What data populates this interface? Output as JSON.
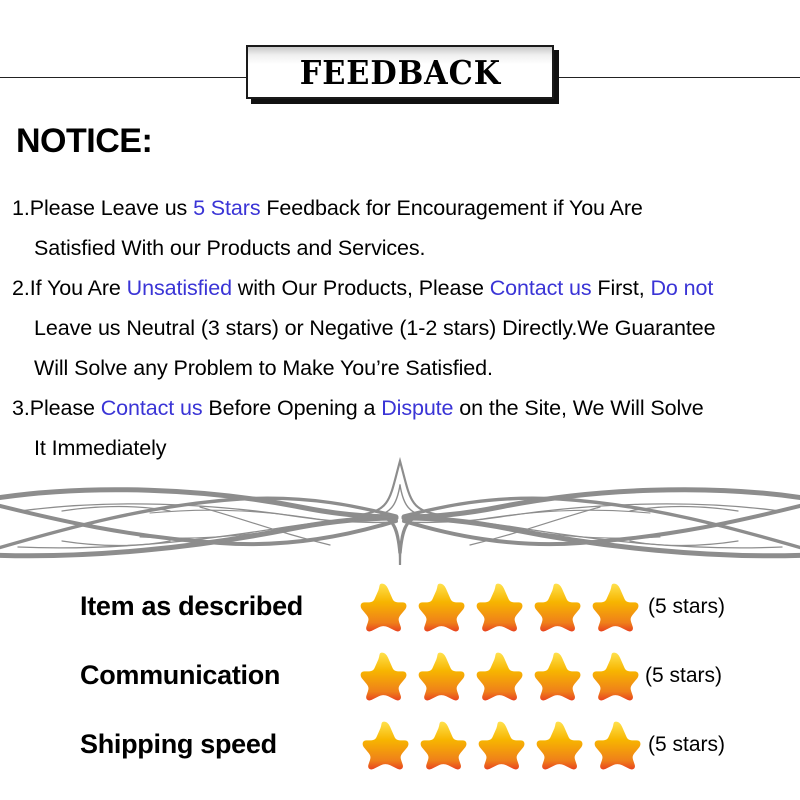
{
  "banner": {
    "title": "FEEDBACK"
  },
  "notice": {
    "heading": "NOTICE:",
    "highlight_color": "#3a34d6",
    "items": [
      {
        "lines": [
          [
            {
              "text": "1.Please Leave us ",
              "color": "black"
            },
            {
              "text": " 5 Stars ",
              "color": "highlight"
            },
            {
              "text": " Feedback for  Encouragement  if You Are",
              "color": "black"
            }
          ],
          [
            {
              "text": "Satisfied With our Products and Services.",
              "color": "black"
            }
          ]
        ]
      },
      {
        "lines": [
          [
            {
              "text": "2.If You Are ",
              "color": "black"
            },
            {
              "text": "Unsatisfied",
              "color": "highlight"
            },
            {
              "text": " with Our Products, Please ",
              "color": "black"
            },
            {
              "text": "Contact us",
              "color": "highlight"
            },
            {
              "text": " First, ",
              "color": "black"
            },
            {
              "text": "Do not",
              "color": "highlight"
            }
          ],
          [
            {
              "text": "Leave us Neutral (3 stars) or Negative (1-2 stars) Directly.We Guarantee",
              "color": "black"
            }
          ],
          [
            {
              "text": "Will Solve any Problem to Make You’re  Satisfied.",
              "color": "black"
            }
          ]
        ]
      },
      {
        "lines": [
          [
            {
              "text": "3.Please ",
              "color": "black"
            },
            {
              "text": "Contact us",
              "color": "highlight"
            },
            {
              "text": " Before Opening a ",
              "color": "black"
            },
            {
              "text": "Dispute",
              "color": "highlight"
            },
            {
              "text": " on the Site, We Will Solve",
              "color": "black"
            }
          ],
          [
            {
              "text": "It Immediately",
              "color": "black"
            }
          ]
        ]
      }
    ]
  },
  "ornament": {
    "name": "decorative-flourish-divider",
    "stroke_color": "#8d8d8d"
  },
  "ratings": {
    "star_colors": {
      "top": "#ffe14d",
      "mid": "#f7b500",
      "bottom": "#ef7f1a",
      "edge": "#e8431f"
    },
    "rows": [
      {
        "label": "Item as described",
        "stars": 5,
        "count_label": "(5 stars)"
      },
      {
        "label": "Communication",
        "stars": 5,
        "count_label": "(5 stars)"
      },
      {
        "label": "Shipping speed",
        "stars": 5,
        "count_label": "(5 stars)"
      }
    ]
  }
}
